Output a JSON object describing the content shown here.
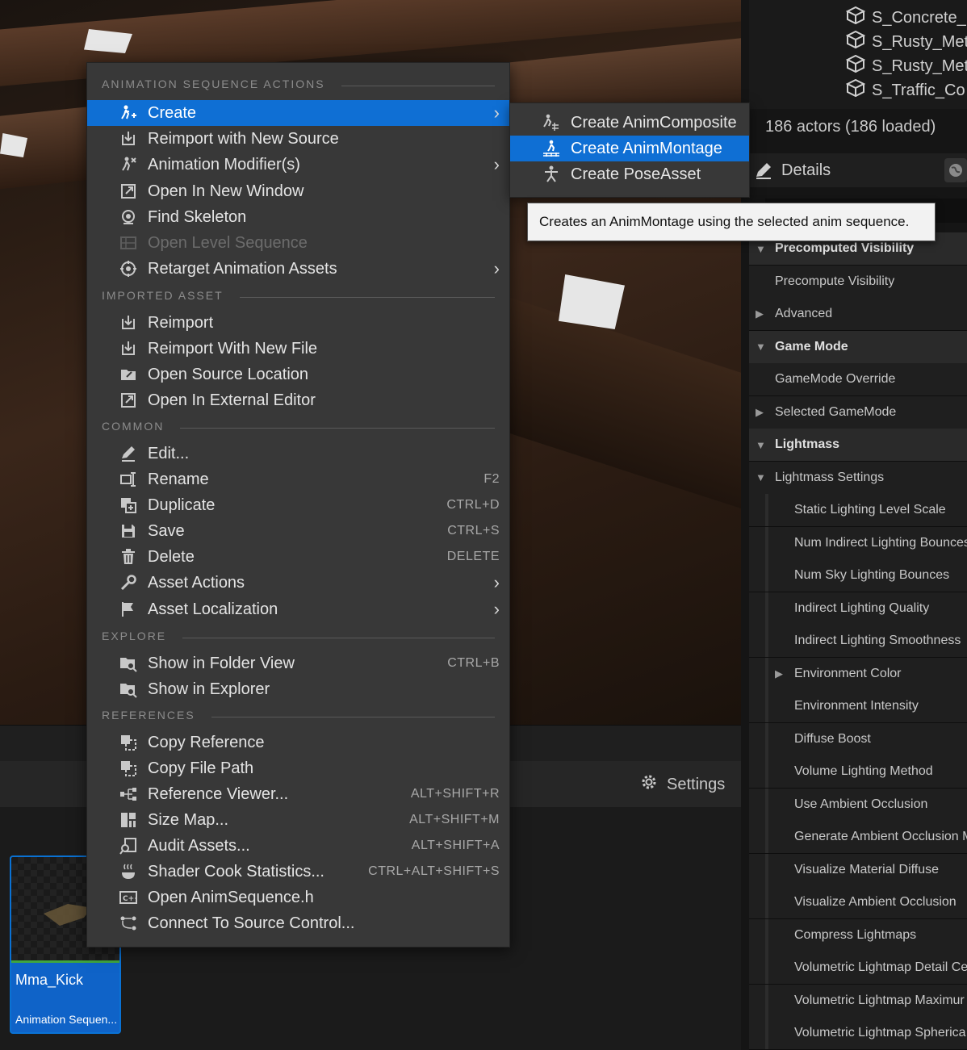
{
  "menu": {
    "sections": [
      {
        "title": "ANIMATION SEQUENCE ACTIONS"
      },
      {
        "title": "IMPORTED ASSET"
      },
      {
        "title": "COMMON"
      },
      {
        "title": "EXPLORE"
      },
      {
        "title": "REFERENCES"
      }
    ],
    "items": [
      {
        "label": "Create",
        "icon": "create-anim-icon"
      },
      {
        "label": "Reimport with New Source",
        "icon": "reimport-icon"
      },
      {
        "label": "Animation Modifier(s)",
        "icon": "modifier-icon"
      },
      {
        "label": "Open In New Window",
        "icon": "open-window-icon"
      },
      {
        "label": "Find Skeleton",
        "icon": "find-icon"
      },
      {
        "label": "Open Level Sequence",
        "icon": "sequence-icon"
      },
      {
        "label": "Retarget Animation Assets",
        "icon": "retarget-icon"
      },
      {
        "label": "Reimport",
        "icon": "reimport-icon"
      },
      {
        "label": "Reimport With New File",
        "icon": "reimport-icon"
      },
      {
        "label": "Open Source Location",
        "icon": "folder-icon"
      },
      {
        "label": "Open In External Editor",
        "icon": "external-editor-icon"
      },
      {
        "label": "Edit...",
        "icon": "edit-icon"
      },
      {
        "label": "Rename",
        "shortcut": "F2",
        "icon": "rename-icon"
      },
      {
        "label": "Duplicate",
        "shortcut": "CTRL+D",
        "icon": "duplicate-icon"
      },
      {
        "label": "Save",
        "shortcut": "CTRL+S",
        "icon": "save-icon"
      },
      {
        "label": "Delete",
        "shortcut": "DELETE",
        "icon": "delete-icon"
      },
      {
        "label": "Asset Actions",
        "icon": "wrench-icon"
      },
      {
        "label": "Asset Localization",
        "icon": "flag-icon"
      },
      {
        "label": "Show in Folder View",
        "shortcut": "CTRL+B",
        "icon": "folder-search-icon"
      },
      {
        "label": "Show in Explorer",
        "icon": "folder-search-icon"
      },
      {
        "label": "Copy Reference",
        "icon": "copy-icon"
      },
      {
        "label": "Copy File Path",
        "icon": "copy-icon"
      },
      {
        "label": "Reference Viewer...",
        "shortcut": "ALT+SHIFT+R",
        "icon": "reference-viewer-icon"
      },
      {
        "label": "Size Map...",
        "shortcut": "ALT+SHIFT+M",
        "icon": "size-map-icon"
      },
      {
        "label": "Audit Assets...",
        "shortcut": "ALT+SHIFT+A",
        "icon": "audit-icon"
      },
      {
        "label": "Shader Cook Statistics...",
        "shortcut": "CTRL+ALT+SHIFT+S",
        "icon": "shader-icon"
      },
      {
        "label": "Open AnimSequence.h",
        "icon": "cpp-icon"
      },
      {
        "label": "Connect To Source Control...",
        "icon": "source-control-icon"
      }
    ],
    "chevron": "›"
  },
  "submenu": {
    "items": [
      {
        "label": "Create AnimComposite",
        "icon": "anim-composite-icon"
      },
      {
        "label": "Create AnimMontage",
        "icon": "anim-montage-icon"
      },
      {
        "label": "Create PoseAsset",
        "icon": "pose-asset-icon"
      }
    ]
  },
  "tooltip": {
    "text": "Creates an AnimMontage using the selected anim sequence."
  },
  "outliner": {
    "items": [
      "S_Concrete_F",
      "S_Rusty_Met",
      "S_Rusty_Met",
      "S_Traffic_Co"
    ],
    "actors": "186 actors (186 loaded)"
  },
  "details": {
    "title": "Details",
    "rows": [
      {
        "label": "Precomputed Visibility",
        "kind": "category",
        "arrow": "▼"
      },
      {
        "label": "Precompute Visibility",
        "kind": "prop"
      },
      {
        "label": "Advanced",
        "kind": "prop",
        "arrow": "▶"
      },
      {
        "label": "Game Mode",
        "kind": "category",
        "arrow": "▼"
      },
      {
        "label": "GameMode Override",
        "kind": "prop"
      },
      {
        "label": "Selected GameMode",
        "kind": "prop",
        "arrow": "▶"
      },
      {
        "label": "Lightmass",
        "kind": "category",
        "arrow": "▼"
      },
      {
        "label": "Lightmass Settings",
        "kind": "prop",
        "arrow": "▼"
      },
      {
        "label": "Static Lighting Level Scale",
        "kind": "sub"
      },
      {
        "label": "Num Indirect Lighting Bounces",
        "kind": "sub"
      },
      {
        "label": "Num Sky Lighting Bounces",
        "kind": "sub"
      },
      {
        "label": "Indirect Lighting Quality",
        "kind": "sub"
      },
      {
        "label": "Indirect Lighting Smoothness",
        "kind": "sub"
      },
      {
        "label": "Environment Color",
        "kind": "sub",
        "arrow": "▶"
      },
      {
        "label": "Environment Intensity",
        "kind": "sub"
      },
      {
        "label": "Diffuse Boost",
        "kind": "sub"
      },
      {
        "label": "Volume Lighting Method",
        "kind": "sub"
      },
      {
        "label": "Use Ambient Occlusion",
        "kind": "sub"
      },
      {
        "label": "Generate Ambient Occlusion M",
        "kind": "sub"
      },
      {
        "label": "Visualize Material Diffuse",
        "kind": "sub"
      },
      {
        "label": "Visualize Ambient Occlusion",
        "kind": "sub"
      },
      {
        "label": "Compress Lightmaps",
        "kind": "sub"
      },
      {
        "label": "Volumetric Lightmap Detail Ce",
        "kind": "sub"
      },
      {
        "label": "Volumetric Lightmap Maximur",
        "kind": "sub"
      },
      {
        "label": "Volumetric Lightmap Spherica",
        "kind": "sub"
      }
    ]
  },
  "content_browser": {
    "settings_label": "Settings",
    "asset": {
      "name": "Mma_Kick",
      "type": "Animation Sequen..."
    }
  },
  "colors": {
    "accent": "#0f6fd4",
    "menu_bg": "#383838",
    "asset_strip": "#3fa640"
  }
}
